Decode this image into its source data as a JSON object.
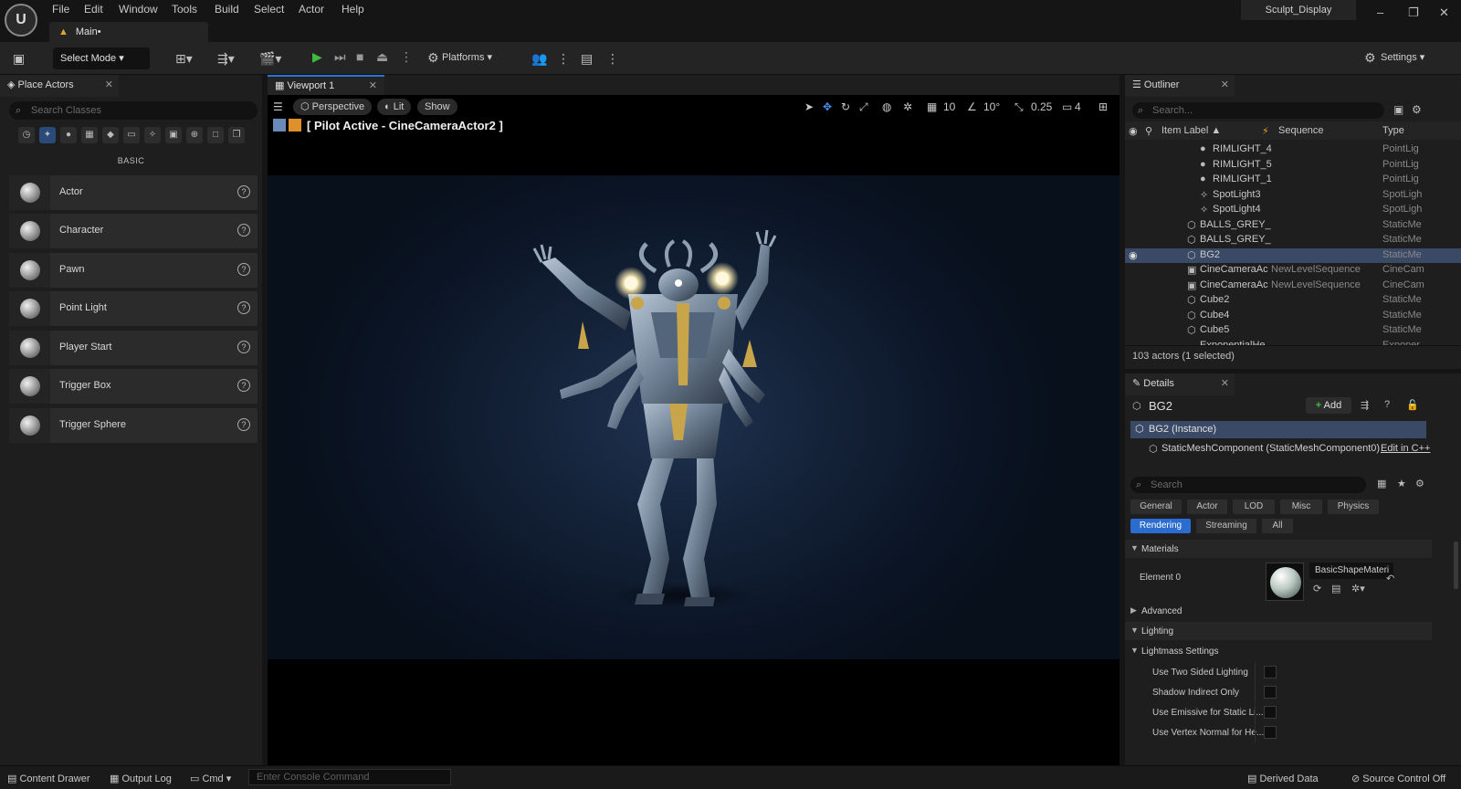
{
  "app": {
    "logo": "U",
    "doc_tab": "Main•",
    "project": "Sculpt_Display"
  },
  "menu": [
    "File",
    "Edit",
    "Window",
    "Tools",
    "Build",
    "Select",
    "Actor",
    "Help"
  ],
  "window_controls": {
    "minimize": "–",
    "maximize": "❐",
    "close": "✕"
  },
  "toolbar": {
    "select_mode": "Select Mode",
    "platforms": "Platforms",
    "settings": "Settings"
  },
  "place_actors": {
    "tab": "Place Actors",
    "search_placeholder": "Search Classes",
    "category_header": "BASIC",
    "items": [
      {
        "label": "Actor"
      },
      {
        "label": "Character"
      },
      {
        "label": "Pawn"
      },
      {
        "label": "Point Light"
      },
      {
        "label": "Player Start"
      },
      {
        "label": "Trigger Box"
      },
      {
        "label": "Trigger Sphere"
      }
    ]
  },
  "viewport": {
    "tab": "Viewport 1",
    "perspective": "Perspective",
    "lit": "Lit",
    "show": "Show",
    "grid_snap": "10",
    "rot_snap": "10°",
    "scale_snap": "0.25",
    "cam_speed": "4",
    "pilot_text": "[ Pilot Active - CineCameraActor2 ]"
  },
  "outliner": {
    "tab": "Outliner",
    "search_placeholder": "Search...",
    "columns": {
      "label": "Item Label ▲",
      "sequence": "Sequence",
      "type": "Type"
    },
    "rows": [
      {
        "name": "RIMLIGHT_4",
        "seq": "",
        "type": "PointLig",
        "icon": "bulb",
        "indent": 1
      },
      {
        "name": "RIMLIGHT_5",
        "seq": "",
        "type": "PointLig",
        "icon": "bulb",
        "indent": 1
      },
      {
        "name": "RIMLIGHT_1",
        "seq": "",
        "type": "PointLig",
        "icon": "bulb",
        "indent": 1
      },
      {
        "name": "SpotLight3",
        "seq": "",
        "type": "SpotLigh",
        "icon": "spot",
        "indent": 1
      },
      {
        "name": "SpotLight4",
        "seq": "",
        "type": "SpotLigh",
        "icon": "spot",
        "indent": 1
      },
      {
        "name": "BALLS_GREY_",
        "seq": "",
        "type": "StaticMe",
        "icon": "mesh",
        "indent": 0
      },
      {
        "name": "BALLS_GREY_",
        "seq": "",
        "type": "StaticMe",
        "icon": "mesh",
        "indent": 0
      },
      {
        "name": "BG2",
        "seq": "",
        "type": "StaticMe",
        "icon": "mesh",
        "indent": 0,
        "selected": true
      },
      {
        "name": "CineCameraAc",
        "seq": "NewLevelSequence",
        "type": "CineCam",
        "icon": "camera",
        "indent": 0
      },
      {
        "name": "CineCameraAc",
        "seq": "NewLevelSequence",
        "type": "CineCam",
        "icon": "camera",
        "indent": 0
      },
      {
        "name": "Cube2",
        "seq": "",
        "type": "StaticMe",
        "icon": "mesh",
        "indent": 0
      },
      {
        "name": "Cube4",
        "seq": "",
        "type": "StaticMe",
        "icon": "mesh",
        "indent": 0
      },
      {
        "name": "Cube5",
        "seq": "",
        "type": "StaticMe",
        "icon": "mesh",
        "indent": 0
      },
      {
        "name": "ExponentialHe",
        "seq": "",
        "type": "Exponer",
        "icon": "fog",
        "indent": 0
      }
    ],
    "count": "103 actors (1 selected)"
  },
  "details": {
    "tab": "Details",
    "title": "BG2",
    "add": "Add",
    "instance": "BG2 (Instance)",
    "component": "StaticMeshComponent (StaticMeshComponent0)",
    "edit_cpp": "Edit in C++",
    "search_placeholder": "Search",
    "filters_row1": [
      "General",
      "Actor",
      "LOD",
      "Misc",
      "Physics"
    ],
    "filters_row2": [
      "Rendering",
      "Streaming",
      "All"
    ],
    "sections": {
      "materials": "Materials",
      "advanced": "Advanced",
      "lighting": "Lighting",
      "lightmass": "Lightmass Settings"
    },
    "element0": "Element 0",
    "material_name": "BasicShapeMateri",
    "props": [
      "Use Two Sided Lighting",
      "Shadow Indirect Only",
      "Use Emissive for Static Li...",
      "Use Vertex Normal for He..."
    ]
  },
  "statusbar": {
    "content_drawer": "Content Drawer",
    "output_log": "Output Log",
    "cmd": "Cmd",
    "console_placeholder": "Enter Console Command",
    "derived_data": "Derived Data",
    "source_control": "Source Control Off"
  },
  "colors": {
    "accent": "#2a6cd0",
    "selection": "#3a4a66",
    "play_green": "#3fbb3f",
    "warning": "#e8a030"
  }
}
